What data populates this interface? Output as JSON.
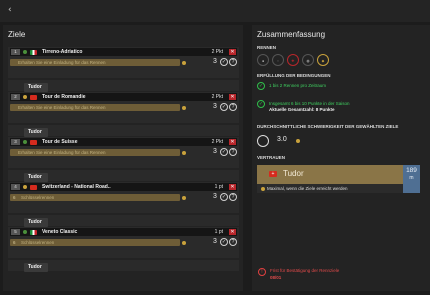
{
  "topbar": {
    "back_icon": "‹"
  },
  "left": {
    "title": "Ziele",
    "races": [
      {
        "idx": "1",
        "name": "Tirreno-Adriatico",
        "points": "2 Pkt",
        "dot": "#4a8f3a",
        "flag": "italy",
        "goal_text": "Erhalten Sie eine Einladung für das Rennen",
        "count": "3",
        "sponsor": "Tudor"
      },
      {
        "idx": "2",
        "name": "Tour de Romandie",
        "points": "2 Pkt",
        "dot": "#c9a23c",
        "flag": "switzerland",
        "goal_text": "Erhalten Sie eine Einladung für das Rennen",
        "count": "3",
        "sponsor": "Tudor"
      },
      {
        "idx": "3",
        "name": "Tour de Suisse",
        "points": "2 Pkt",
        "dot": "#4a8f3a",
        "flag": "switzerland",
        "goal_text": "Erhalten Sie eine Einladung für das Rennen",
        "count": "3",
        "sponsor": "Tudor"
      },
      {
        "idx": "4",
        "name": "Switzerland - National Road..",
        "points": "1 pt",
        "dot": "#c9a23c",
        "flag": "switzerland",
        "goal_text": "Schlüsselrennen",
        "goal_num": "6",
        "count": "3",
        "sponsor": "Tudor"
      },
      {
        "idx": "5",
        "name": "Veneto Classic",
        "points": "1 pt",
        "dot": "#4a8f3a",
        "flag": "italy",
        "goal_text": "Schlüsselrennen",
        "goal_num": "6",
        "count": "3",
        "sponsor": "Tudor"
      }
    ]
  },
  "right": {
    "title": "Zusammenfassung",
    "section_races": "RENNEN",
    "section_conditions": "ERFÜLLUNG DER BEDINGUNGEN",
    "cond1": "1 bis 2 Rennen pro Zeitraum",
    "cond2_green": "Insgesamt 6 bis 10 Punkte in der Saison",
    "cond2_white": "Aktuelle Gesamtzahl: 8 Punkte",
    "section_difficulty": "DURCHSCHNITTLICHE SCHWIERIGKEIT DER GEWÄHLTEN ZIELE",
    "difficulty": "3.0",
    "section_trust": "VERTRAUEN",
    "trust_team": "Tudor",
    "trust_note": "Maximal, wenn die Ziele erreicht werden",
    "trust_value": "189",
    "trust_unit": "m",
    "deadline_label": "Frist für Bestätigung der Rennziele",
    "deadline_date": "08/01"
  },
  "colors": {
    "accent_gold": "#6e5d37",
    "danger": "#b8262b",
    "ok": "#2fbf4a",
    "trust_blue": "#4f6f93"
  }
}
